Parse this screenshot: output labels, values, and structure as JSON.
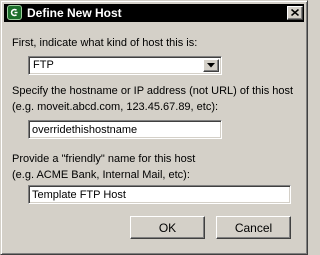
{
  "window": {
    "title": "Define New Host",
    "app_icon": "moveit-icon",
    "close_icon": "close-icon"
  },
  "host_type": {
    "label": "First, indicate what kind of host this is:",
    "selected": "FTP",
    "dropdown_icon": "chevron-down-icon"
  },
  "hostname": {
    "label_line1": "Specify the hostname or IP address (not URL) of this host",
    "label_line2": "(e.g. moveit.abcd.com, 123.45.67.89, etc):",
    "value": "overridethishostname"
  },
  "friendly_name": {
    "label_line1": "Provide a \"friendly\" name for this host",
    "label_line2": "(e.g. ACME Bank, Internal Mail, etc):",
    "value": "Template FTP Host"
  },
  "buttons": {
    "ok": "OK",
    "cancel": "Cancel"
  },
  "colors": {
    "titlebar_bg": "#000000",
    "dialog_bg": "#d4d0c8",
    "title_text": "#ffffff"
  }
}
